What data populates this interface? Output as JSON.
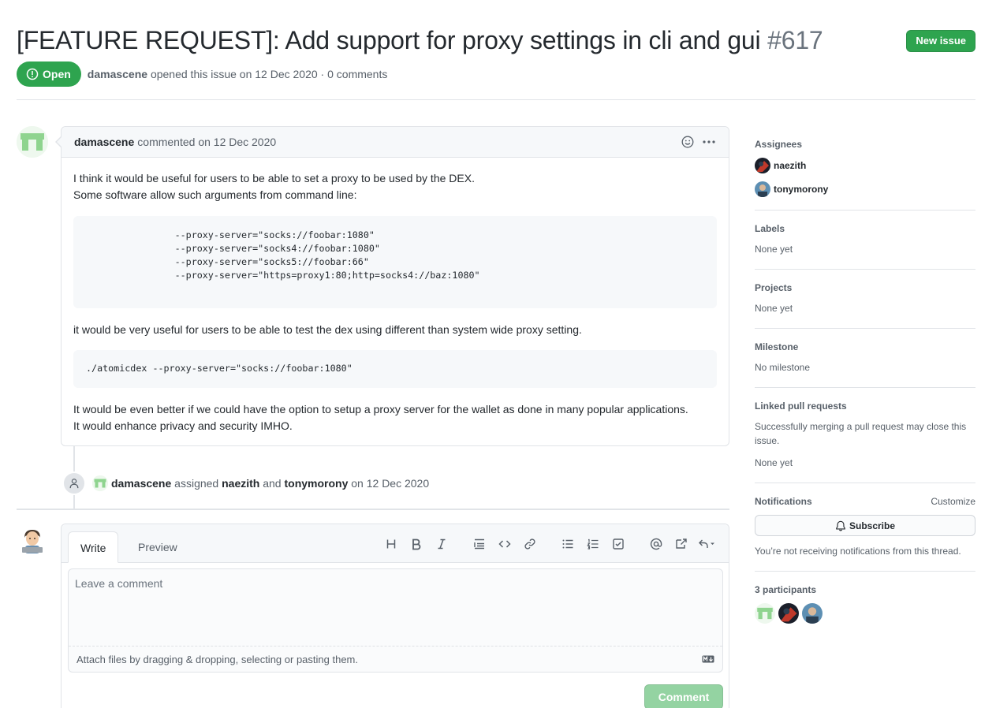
{
  "issue": {
    "title": "[FEATURE REQUEST]: Add support for proxy settings in cli and gui",
    "number": "#617",
    "new_issue_label": "New issue",
    "state": "Open",
    "author": "damascene",
    "meta_opened": "opened this issue on 12 Dec 2020 · 0 comments"
  },
  "comment": {
    "author": "damascene",
    "meta": "commented on 12 Dec 2020",
    "body_line1": "I think it would be useful for users to be able to set a proxy to be used by the DEX.",
    "body_line2": "Some software allow such arguments from command line:",
    "code1": "                --proxy-server=\"socks://foobar:1080\"\n                --proxy-server=\"socks4://foobar:1080\"\n                --proxy-server=\"socks5://foobar:66\"\n                --proxy-server=\"https=proxy1:80;http=socks4://baz:1080\"",
    "body_line3": "it would be very useful for users to be able to test the dex using different than system wide proxy setting.",
    "code2": "./atomicdex --proxy-server=\"socks://foobar:1080\"",
    "body_line4": "It would be even better if we could have the option to setup a proxy server for the wallet as done in many popular applications.",
    "body_line5": "It would enhance privacy and security IMHO."
  },
  "event": {
    "actor": "damascene",
    "action": "assigned",
    "assignee1": "naezith",
    "conj": "and",
    "assignee2": "tonymorony",
    "date": "on 12 Dec 2020"
  },
  "editor": {
    "tab_write": "Write",
    "tab_preview": "Preview",
    "placeholder": "Leave a comment",
    "attach_hint": "Attach files by dragging & dropping, selecting or pasting them.",
    "submit_label": "Comment"
  },
  "sidebar": {
    "assignees_title": "Assignees",
    "assignees": [
      "naezith",
      "tonymorony"
    ],
    "labels_title": "Labels",
    "labels_value": "None yet",
    "projects_title": "Projects",
    "projects_value": "None yet",
    "milestone_title": "Milestone",
    "milestone_value": "No milestone",
    "linked_title": "Linked pull requests",
    "linked_desc": "Successfully merging a pull request may close this issue.",
    "linked_value": "None yet",
    "notifications_title": "Notifications",
    "customize_label": "Customize",
    "subscribe_label": "Subscribe",
    "notifications_desc": "You’re not receiving notifications from this thread.",
    "participants_title": "3 participants"
  },
  "colors": {
    "open_green": "#2ea44f",
    "border": "#e1e4e8",
    "muted": "#586069"
  }
}
